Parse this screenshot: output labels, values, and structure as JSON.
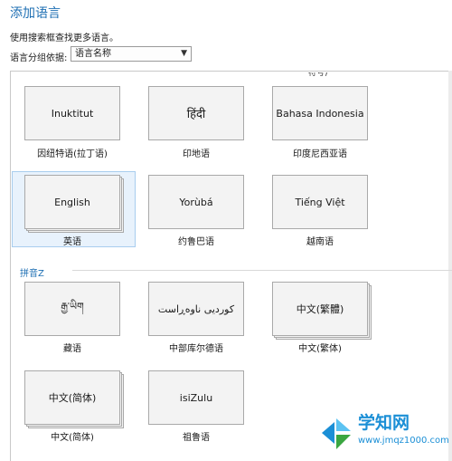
{
  "header": {
    "title": "添加语言",
    "hint": "使用搜索框查找更多语言。",
    "group_by_label": "语言分组依据:",
    "group_by_value": "语言名称"
  },
  "list": {
    "cut_off_text": "符号)",
    "section_z_label": "拼音Z",
    "tiles": [
      {
        "display": "Inuktitut",
        "caption": "因纽特语(拉丁语)"
      },
      {
        "display": "हिंदी",
        "caption": "印地语"
      },
      {
        "display": "Bahasa Indonesia",
        "caption": "印度尼西亚语"
      },
      {
        "display": "English",
        "caption": "英语",
        "selected": true
      },
      {
        "display": "Yorùbá",
        "caption": "约鲁巴语"
      },
      {
        "display": "Tiếng Việt",
        "caption": "越南语"
      },
      {
        "display": "རྒྱ་ཡིག",
        "caption": "藏语"
      },
      {
        "display": "کوردیی ناوەڕاست",
        "caption": "中部库尔德语"
      },
      {
        "display": "中文(繁體)",
        "caption": "中文(繁体)"
      },
      {
        "display": "中文(简体)",
        "caption": "中文(简体)"
      },
      {
        "display": "isiZulu",
        "caption": "祖鲁语"
      }
    ]
  },
  "watermark": {
    "name": "学知网",
    "url": "www.jmqz1000.com"
  },
  "colors": {
    "accent": "#1e6fb3",
    "tile_bg": "#f3f3f3",
    "selected_bg": "#e8f2fc",
    "watermark": "#1b8fd6"
  }
}
